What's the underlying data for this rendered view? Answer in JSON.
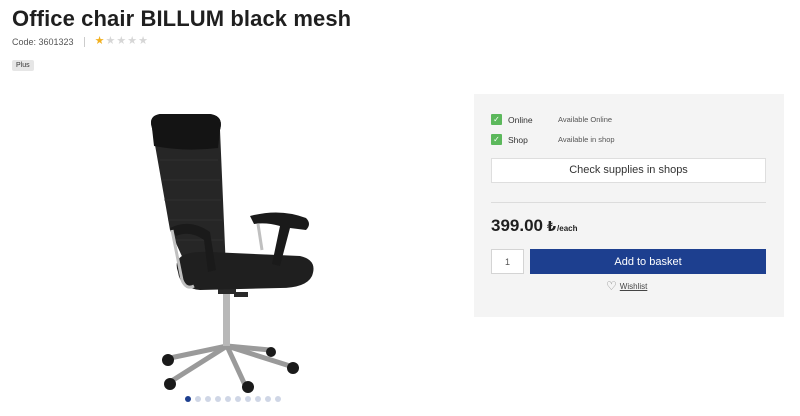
{
  "product": {
    "title": "Office chair BILLUM black mesh",
    "code_text": "Code: 3601323",
    "rating": 1,
    "rating_max": 5,
    "badge": "Plus"
  },
  "gallery": {
    "image_count": 10,
    "active_index": 0
  },
  "availability": [
    {
      "label": "Online",
      "status": "Available Online",
      "checked": true
    },
    {
      "label": "Shop",
      "status": "Available in shop",
      "checked": true
    }
  ],
  "actions": {
    "check_supplies": "Check supplies in shops",
    "add_to_basket": "Add to basket",
    "wishlist": "Wishlist"
  },
  "price": {
    "amount": "399.00",
    "currency_symbol": "₺",
    "unit": "/each"
  },
  "quantity": {
    "value": "1"
  },
  "colors": {
    "primary": "#1d3f8f",
    "check_green": "#5cb85c",
    "star_active": "#f2b01e"
  }
}
